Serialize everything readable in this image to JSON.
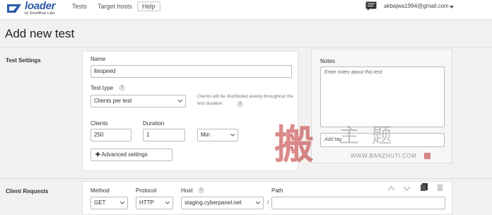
{
  "header": {
    "logo_text": "loader",
    "logo_sub": "by SmartBear Labs",
    "nav": {
      "tests": "Tests",
      "target_hosts": "Target hosts",
      "help": "Help"
    },
    "user_email": "akbajwa1994@gmail.com"
  },
  "page": {
    "title": "Add new test"
  },
  "test_settings": {
    "section_label": "Test Settings",
    "name_label": "Name",
    "name_value": "ltespeed",
    "test_type_label": "Test type",
    "test_type_value": "Clients per test",
    "test_type_hint": "Clients will be distributed evenly throughout the test duration",
    "clients_label": "Clients",
    "clients_value": "250",
    "duration_label": "Duration",
    "duration_value": "1",
    "duration_unit": "Min",
    "advanced_label": "Advanced settings"
  },
  "notes": {
    "label": "Notes",
    "placeholder": "Enter notes about this test",
    "tag_placeholder": "Add tag"
  },
  "client_requests": {
    "section_label": "Client Requests",
    "method_label": "Method",
    "method_value": "GET",
    "protocol_label": "Protocol",
    "protocol_value": "HTTP",
    "host_label": "Host",
    "host_value": "staging.cyberpanel.net",
    "path_label": "Path",
    "path_separator": "/"
  },
  "watermark": {
    "chars_big": "搬",
    "chars_mid": "主题",
    "url": "WWW.BANZHUTI.COM"
  },
  "colors": {
    "brand": "#2b5ba7",
    "watermark_red": "#be2828"
  },
  "icons": [
    "chat-icon",
    "caret-down-icon",
    "question-icon",
    "plus-icon",
    "arrow-up-icon",
    "arrow-down-icon",
    "copy-icon",
    "trash-icon"
  ]
}
